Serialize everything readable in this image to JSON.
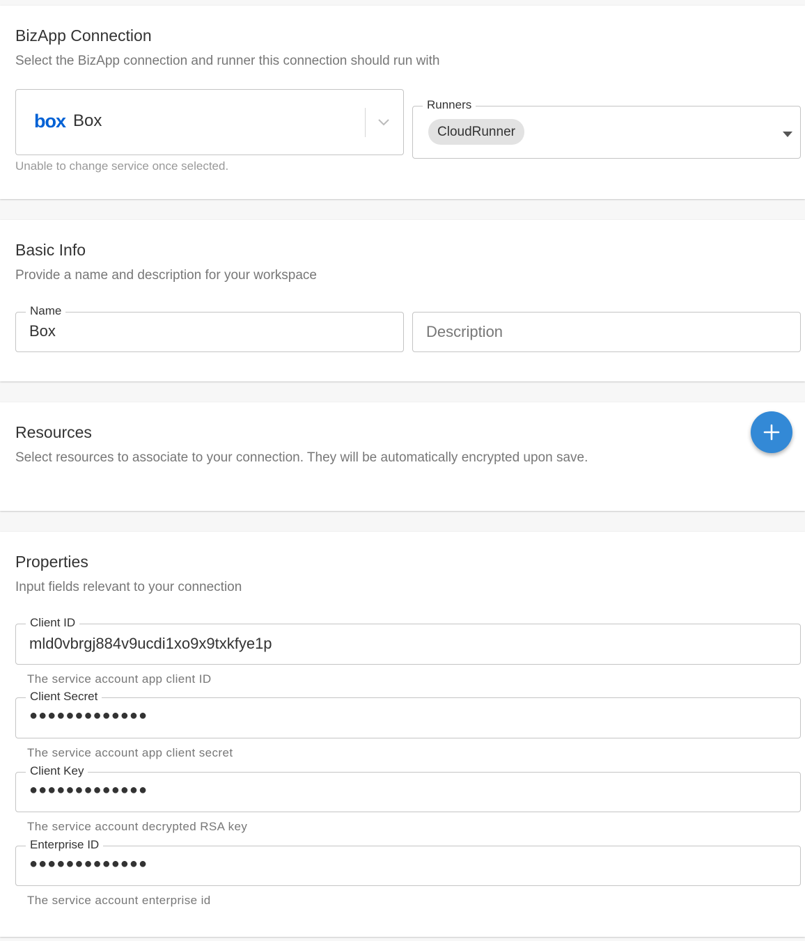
{
  "bizapp": {
    "title": "BizApp Connection",
    "subtitle": "Select the BizApp connection and runner this connection should run with",
    "service": {
      "logo_text": "box",
      "name": "Box",
      "helper": "Unable to change service once selected."
    },
    "runners": {
      "label": "Runners",
      "selected_chip": "CloudRunner"
    }
  },
  "basic_info": {
    "title": "Basic Info",
    "subtitle": "Provide a name and description for your workspace",
    "name": {
      "label": "Name",
      "value": "Box"
    },
    "description": {
      "placeholder": "Description"
    }
  },
  "resources": {
    "title": "Resources",
    "subtitle": "Select resources to associate to your connection. They will be automatically encrypted upon save."
  },
  "properties": {
    "title": "Properties",
    "subtitle": "Input fields relevant to your connection",
    "fields": [
      {
        "label": "Client ID",
        "value": "mld0vbrgj884v9ucdi1xo9x9txkfye1p",
        "helper": "The service account app client ID"
      },
      {
        "label": "Client Secret",
        "value": "●●●●●●●●●●●●●",
        "helper": "The service account app client secret"
      },
      {
        "label": "Client Key",
        "value": "●●●●●●●●●●●●●",
        "helper": "The service account decrypted RSA key"
      },
      {
        "label": "Enterprise ID",
        "value": "●●●●●●●●●●●●●",
        "helper": "The service account enterprise id"
      }
    ]
  },
  "colors": {
    "accent": "#3389d6",
    "box_brand": "#0061d5"
  }
}
